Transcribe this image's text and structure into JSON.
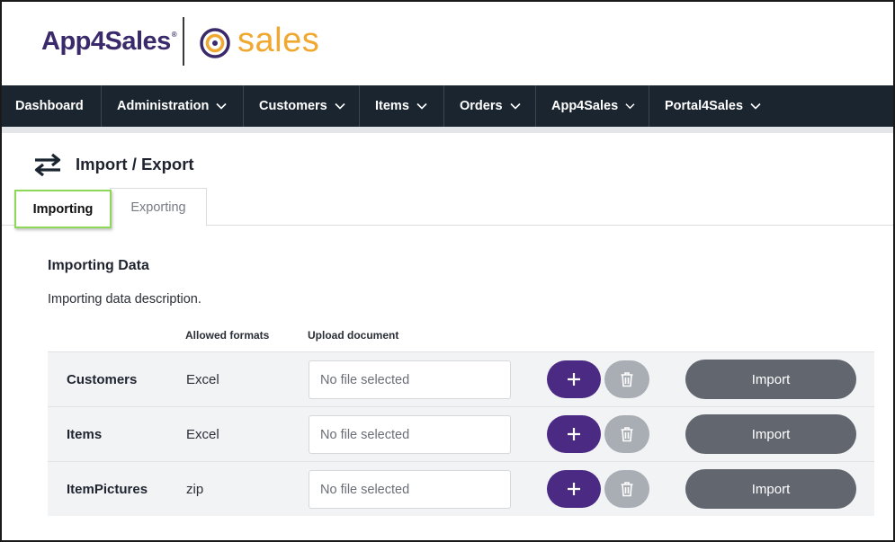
{
  "brand": {
    "app4sales": "App4Sales",
    "registered": "®",
    "sales": "sales",
    "colors": {
      "app4sales": "#3a2a6b",
      "sales": "#f0a830",
      "navbar": "#1b2530",
      "add": "#4b2a83",
      "tab_highlight": "#8ed858"
    }
  },
  "nav": {
    "items": [
      {
        "label": "Dashboard",
        "has_dropdown": false
      },
      {
        "label": "Administration",
        "has_dropdown": true
      },
      {
        "label": "Customers",
        "has_dropdown": true
      },
      {
        "label": "Items",
        "has_dropdown": true
      },
      {
        "label": "Orders",
        "has_dropdown": true
      },
      {
        "label": "App4Sales",
        "has_dropdown": true
      },
      {
        "label": "Portal4Sales",
        "has_dropdown": true
      }
    ]
  },
  "page": {
    "title": "Import / Export",
    "icon": "swap-arrows-icon"
  },
  "tabs": [
    {
      "label": "Importing",
      "active": true
    },
    {
      "label": "Exporting",
      "active": false
    }
  ],
  "section": {
    "title": "Importing Data",
    "description": "Importing data description.",
    "columns": {
      "formats": "Allowed formats",
      "upload": "Upload document"
    }
  },
  "rows": [
    {
      "name": "Customers",
      "format": "Excel",
      "file": "No file selected",
      "import_label": "Import"
    },
    {
      "name": "Items",
      "format": "Excel",
      "file": "No file selected",
      "import_label": "Import"
    },
    {
      "name": "ItemPictures",
      "format": "zip",
      "file": "No file selected",
      "import_label": "Import"
    }
  ]
}
